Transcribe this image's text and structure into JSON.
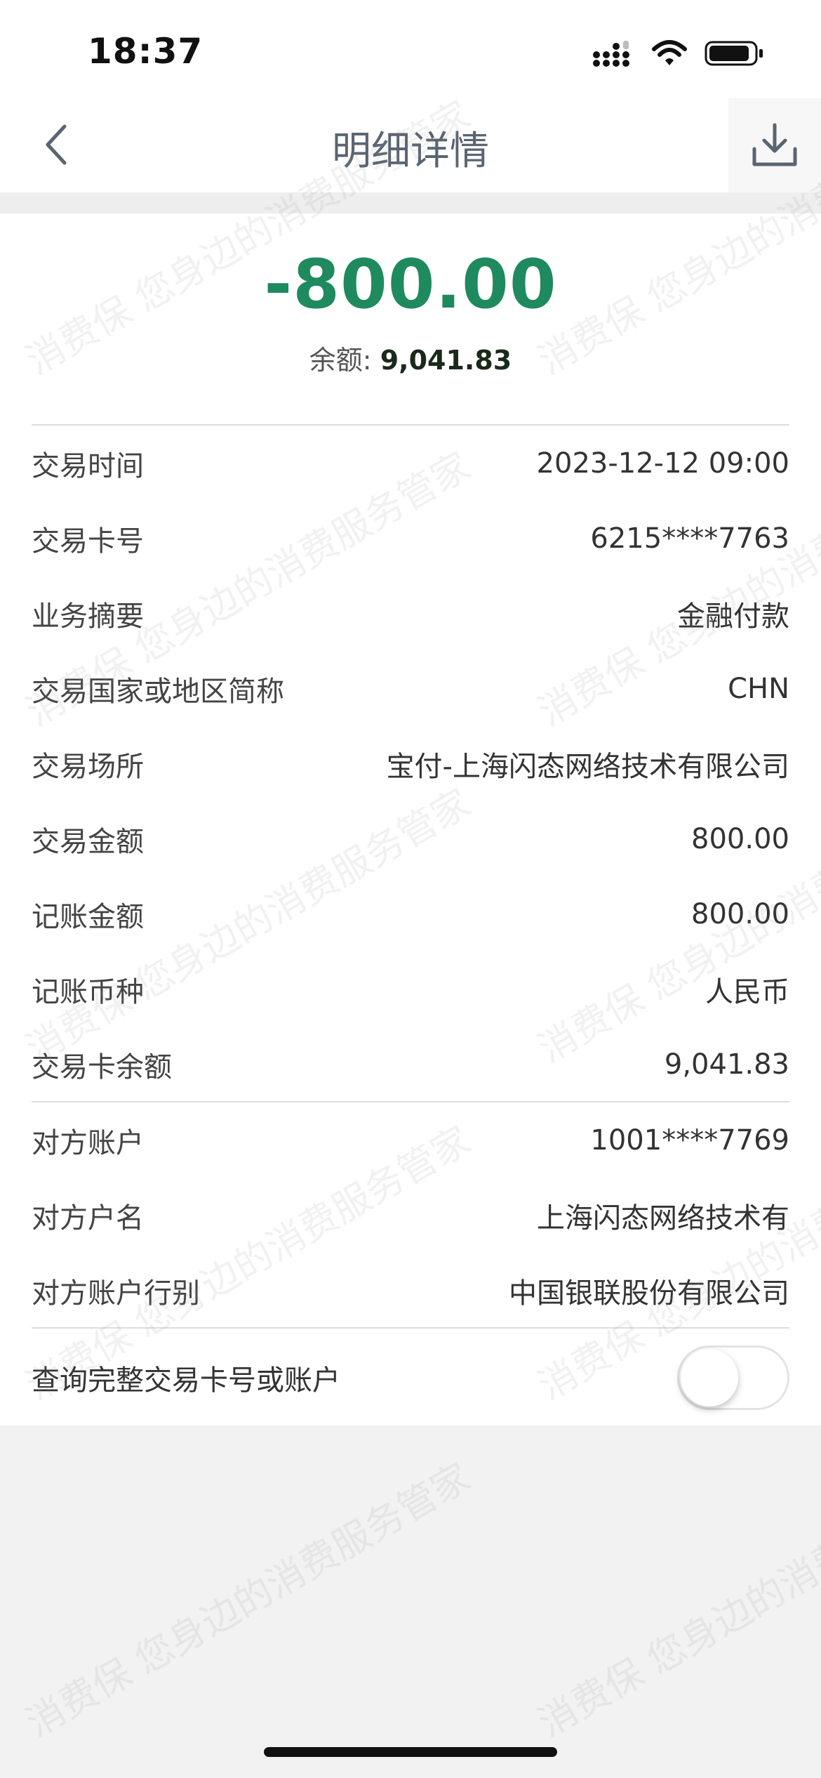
{
  "status_bar": {
    "time": "18:37"
  },
  "nav": {
    "title": "明细详情",
    "back_icon": "chevron-left-icon",
    "download_icon": "download-icon"
  },
  "summary": {
    "amount": "-800.00",
    "balance_label": "余额: ",
    "balance_value": "9,041.83"
  },
  "details": [
    {
      "label": "交易时间",
      "value": "2023-12-12 09:00"
    },
    {
      "label": "交易卡号",
      "value": "6215****7763"
    },
    {
      "label": "业务摘要",
      "value": "金融付款"
    },
    {
      "label": "交易国家或地区简称",
      "value": "CHN"
    },
    {
      "label": "交易场所",
      "value": "宝付-上海闪态网络技术有限公司"
    },
    {
      "label": "交易金额",
      "value": "800.00"
    },
    {
      "label": "记账金额",
      "value": "800.00"
    },
    {
      "label": "记账币种",
      "value": "人民币"
    },
    {
      "label": "交易卡余额",
      "value": "9,041.83"
    }
  ],
  "counterparty": [
    {
      "label": "对方账户",
      "value": "1001****7769"
    },
    {
      "label": "对方户名",
      "value": "上海闪态网络技术有"
    },
    {
      "label": "对方账户行别",
      "value": "中国银联股份有限公司"
    }
  ],
  "toggle": {
    "label": "查询完整交易卡号或账户",
    "state": "off"
  },
  "watermark": {
    "text": "消费保 您身边的消费服务管家"
  },
  "colors": {
    "amount": "#1e8a5e",
    "title": "#5a6572",
    "background": "#f2f2f2"
  }
}
